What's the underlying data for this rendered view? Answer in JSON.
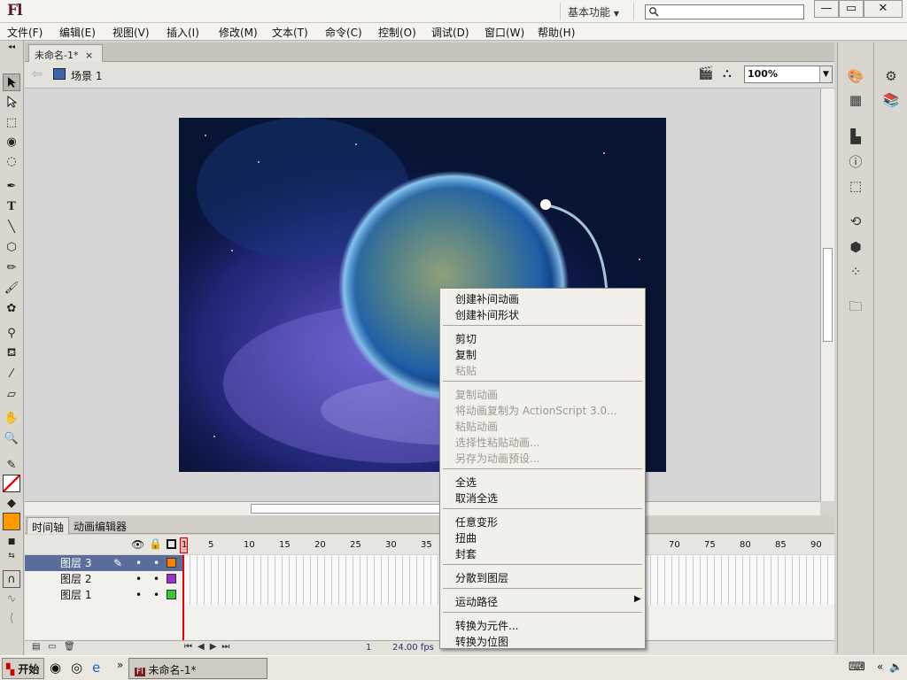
{
  "app": {
    "logo": "Fl",
    "workspace": "基本功能"
  },
  "window_buttons": [
    "—",
    "▭",
    "✕"
  ],
  "menu": [
    "文件(F)",
    "编辑(E)",
    "视图(V)",
    "插入(I)",
    "修改(M)",
    "文本(T)",
    "命令(C)",
    "控制(O)",
    "调试(D)",
    "窗口(W)",
    "帮助(H)"
  ],
  "document": {
    "tab": "未命名-1*",
    "scene": "场景 1",
    "zoom": "100%"
  },
  "timeline": {
    "tabs": [
      "时间轴",
      "动画编辑器"
    ],
    "frame_numbers": [
      "1",
      "5",
      "10",
      "15",
      "20",
      "25",
      "30",
      "35",
      "70",
      "75",
      "80",
      "85",
      "90"
    ],
    "layers": [
      {
        "name": "图层 3",
        "color": "#ff8000"
      },
      {
        "name": "图层 2",
        "color": "#9933cc"
      },
      {
        "name": "图层 1",
        "color": "#33cc33"
      }
    ],
    "current_frame": "1",
    "fps": "24.00 fps"
  },
  "context_menu": {
    "items": [
      {
        "label": "创建补间动画",
        "enabled": true
      },
      {
        "label": "创建补间形状",
        "enabled": true
      },
      {
        "sep": true
      },
      {
        "label": "剪切",
        "enabled": true
      },
      {
        "label": "复制",
        "enabled": true
      },
      {
        "label": "粘贴",
        "enabled": false
      },
      {
        "sep": true
      },
      {
        "label": "复制动画",
        "enabled": false
      },
      {
        "label": "将动画复制为 ActionScript 3.0...",
        "enabled": false
      },
      {
        "label": "粘贴动画",
        "enabled": false
      },
      {
        "label": "选择性粘贴动画...",
        "enabled": false
      },
      {
        "label": "另存为动画预设...",
        "enabled": false
      },
      {
        "sep": true
      },
      {
        "label": "全选",
        "enabled": true
      },
      {
        "label": "取消全选",
        "enabled": true
      },
      {
        "sep": true
      },
      {
        "label": "任意变形",
        "enabled": true
      },
      {
        "label": "扭曲",
        "enabled": true
      },
      {
        "label": "封套",
        "enabled": true
      },
      {
        "sep": true
      },
      {
        "label": "分散到图层",
        "enabled": true
      },
      {
        "sep": true
      },
      {
        "label": "运动路径",
        "enabled": true,
        "submenu": true
      },
      {
        "sep": true
      },
      {
        "label": "转换为元件...",
        "enabled": true
      },
      {
        "label": "转换为位图",
        "enabled": true
      }
    ]
  },
  "taskbar": {
    "start": "开始",
    "task": "未命名-1*"
  }
}
